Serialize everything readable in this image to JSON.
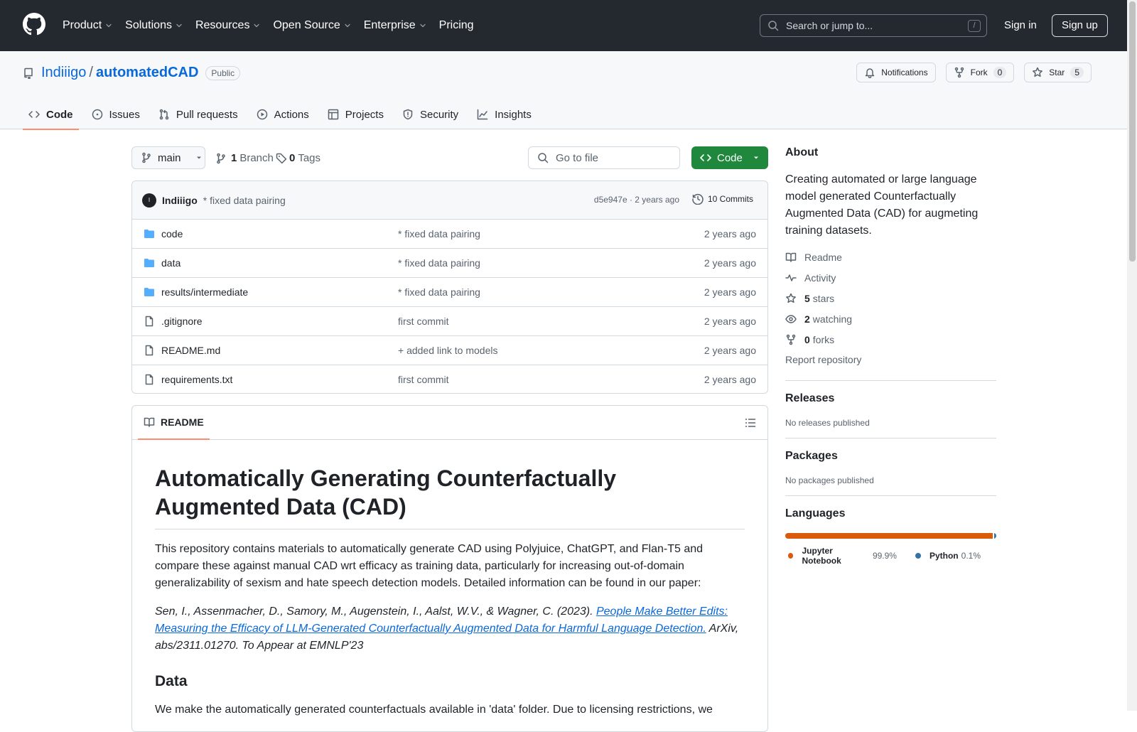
{
  "header": {
    "nav": [
      {
        "label": "Product",
        "dropdown": true
      },
      {
        "label": "Solutions",
        "dropdown": true
      },
      {
        "label": "Resources",
        "dropdown": true
      },
      {
        "label": "Open Source",
        "dropdown": true
      },
      {
        "label": "Enterprise",
        "dropdown": true
      },
      {
        "label": "Pricing",
        "dropdown": false
      }
    ],
    "search_placeholder": "Search or jump to...",
    "search_shortcut": "/",
    "sign_in": "Sign in",
    "sign_up": "Sign up"
  },
  "repo": {
    "owner": "Indiiigo",
    "separator": "/",
    "name": "automatedCAD",
    "visibility": "Public",
    "notifications_label": "Notifications",
    "fork_label": "Fork",
    "fork_count": "0",
    "star_label": "Star",
    "star_count": "5"
  },
  "tabs": [
    {
      "label": "Code",
      "icon": "code-icon",
      "active": true
    },
    {
      "label": "Issues",
      "icon": "issue-icon",
      "active": false
    },
    {
      "label": "Pull requests",
      "icon": "pull-request-icon",
      "active": false
    },
    {
      "label": "Actions",
      "icon": "play-icon",
      "active": false
    },
    {
      "label": "Projects",
      "icon": "table-icon",
      "active": false
    },
    {
      "label": "Security",
      "icon": "shield-icon",
      "active": false
    },
    {
      "label": "Insights",
      "icon": "graph-icon",
      "active": false
    }
  ],
  "toolbar": {
    "branch": "main",
    "branch_count": "1",
    "branch_label": "Branch",
    "tag_count": "0",
    "tag_label": "Tags",
    "go_to_file": "Go to file",
    "code_label": "Code"
  },
  "commit": {
    "avatar_initial": "I",
    "author": "Indiiigo",
    "message": "* fixed data pairing",
    "hash_time": "d5e947e · 2 years ago",
    "commits_label": "10 Commits"
  },
  "files": [
    {
      "name": "code",
      "type": "folder",
      "message": "* fixed data pairing",
      "age": "2 years ago"
    },
    {
      "name": "data",
      "type": "folder",
      "message": "* fixed data pairing",
      "age": "2 years ago"
    },
    {
      "name": "results/intermediate",
      "type": "folder",
      "message": "* fixed data pairing",
      "age": "2 years ago"
    },
    {
      "name": ".gitignore",
      "type": "file",
      "message": "first commit",
      "age": "2 years ago"
    },
    {
      "name": "README.md",
      "type": "file",
      "message": "+ added link to models",
      "age": "2 years ago"
    },
    {
      "name": "requirements.txt",
      "type": "file",
      "message": "first commit",
      "age": "2 years ago"
    }
  ],
  "readme": {
    "tab_label": "README",
    "title": "Automatically Generating Counterfactually Augmented Data (CAD)",
    "intro": "This repository contains materials to automatically generate CAD using Polyjuice, ChatGPT, and Flan-T5 and compare these against manual CAD wrt efficacy as training data, particularly for increasing out-of-domain generalizability of sexism and hate speech detection models. Detailed information can be found in our paper:",
    "cite_prefix": "Sen, I., Assenmacher, D., Samory, M., Augenstein, I., Aalst, W.V., & Wagner, C. (2023). ",
    "cite_link": "People Make Better Edits: Measuring the Efficacy of LLM-Generated Counterfactually Augmented Data for Harmful Language Detection.",
    "cite_suffix": " ArXiv, abs/2311.01270. To Appear at EMNLP'23",
    "data_heading": "Data",
    "data_text": "We make the automatically generated counterfactuals available in 'data' folder. Due to licensing restrictions, we"
  },
  "about": {
    "heading": "About",
    "description": "Creating automated or large language model generated Counterfactually Augmented Data (CAD) for augmeting training datasets.",
    "items": [
      {
        "icon": "book-icon",
        "count": "",
        "label": "Readme"
      },
      {
        "icon": "pulse-icon",
        "count": "",
        "label": "Activity"
      },
      {
        "icon": "star-icon",
        "count": "5",
        "label": "stars"
      },
      {
        "icon": "eye-icon",
        "count": "2",
        "label": "watching"
      },
      {
        "icon": "fork-icon",
        "count": "0",
        "label": "forks"
      }
    ],
    "report": "Report repository"
  },
  "releases": {
    "heading": "Releases",
    "text": "No releases published"
  },
  "packages": {
    "heading": "Packages",
    "text": "No packages published"
  },
  "languages": {
    "heading": "Languages",
    "items": [
      {
        "name": "Jupyter Notebook",
        "percent": "99.9%",
        "value": 99.9,
        "color": "#DA5B0B"
      },
      {
        "name": "Python",
        "percent": "0.1%",
        "value": 0.1,
        "color": "#3572A5"
      }
    ]
  },
  "colors": {
    "header_bg": "#24292f",
    "link": "#0969da",
    "primary_button": "#1f883d",
    "active_tab_underline": "#fd8c73",
    "folder_icon": "#54aeff"
  }
}
